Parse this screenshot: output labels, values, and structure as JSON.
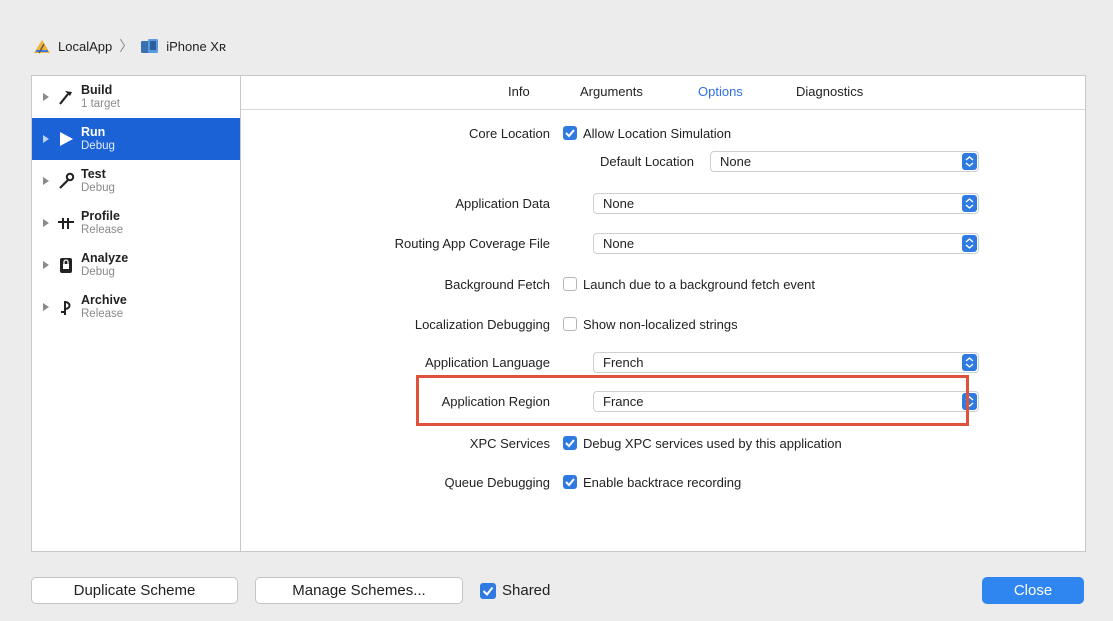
{
  "breadcrumb": {
    "app_icon": "xcode-app-icon",
    "app": "LocalApp",
    "separator": "〉",
    "device_icon": "iphone-device-icon",
    "device": "iPhone Xʀ"
  },
  "sidebar": {
    "items": [
      {
        "name": "Build",
        "sub": "1 target",
        "icon": "hammer-icon",
        "selected": false
      },
      {
        "name": "Run",
        "sub": "Debug",
        "icon": "play-icon",
        "selected": true
      },
      {
        "name": "Test",
        "sub": "Debug",
        "icon": "wrench-icon",
        "selected": false
      },
      {
        "name": "Profile",
        "sub": "Release",
        "icon": "instruments-icon",
        "selected": false
      },
      {
        "name": "Analyze",
        "sub": "Debug",
        "icon": "analyze-icon",
        "selected": false
      },
      {
        "name": "Archive",
        "sub": "Release",
        "icon": "archive-icon",
        "selected": false
      }
    ]
  },
  "tabs": [
    {
      "label": "Info",
      "active": false
    },
    {
      "label": "Arguments",
      "active": false
    },
    {
      "label": "Options",
      "active": true
    },
    {
      "label": "Diagnostics",
      "active": false
    }
  ],
  "options": {
    "core_location": {
      "label": "Core Location",
      "checkbox_text": "Allow Location Simulation",
      "checked": true
    },
    "default_location": {
      "label": "Default Location",
      "value": "None"
    },
    "application_data": {
      "label": "Application Data",
      "value": "None"
    },
    "routing_app": {
      "label": "Routing App Coverage File",
      "value": "None"
    },
    "background_fetch": {
      "label": "Background Fetch",
      "checkbox_text": "Launch due to a background fetch event",
      "checked": false
    },
    "localization_debugging": {
      "label": "Localization Debugging",
      "checkbox_text": "Show non-localized strings",
      "checked": false
    },
    "application_language": {
      "label": "Application Language",
      "value": "French"
    },
    "application_region": {
      "label": "Application Region",
      "value": "France"
    },
    "xpc_services": {
      "label": "XPC Services",
      "checkbox_text": "Debug XPC services used by this application",
      "checked": true
    },
    "queue_debugging": {
      "label": "Queue Debugging",
      "checkbox_text": "Enable backtrace recording",
      "checked": true
    }
  },
  "footer": {
    "duplicate_label": "Duplicate Scheme",
    "manage_label": "Manage Schemes...",
    "shared_label": "Shared",
    "shared_checked": true,
    "close_label": "Close"
  },
  "colors": {
    "accent": "#2f7ae0",
    "selection": "#1a62d6",
    "highlight_border": "#e0513c"
  }
}
